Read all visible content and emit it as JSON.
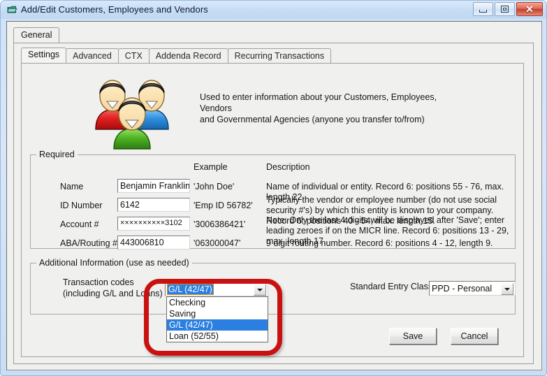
{
  "window": {
    "title": "Add/Edit Customers, Employees and Vendors",
    "icon": "window-folder-icon",
    "minimize_label": "",
    "maximize_label": "",
    "close_label": "✕"
  },
  "outer_tabs": [
    {
      "label": "General",
      "active": true
    }
  ],
  "inner_tabs": [
    {
      "label": "Settings",
      "active": true
    },
    {
      "label": "Advanced",
      "active": false
    },
    {
      "label": "CTX",
      "active": false
    },
    {
      "label": "Addenda Record",
      "active": false
    },
    {
      "label": "Recurring Transactions",
      "active": false
    }
  ],
  "intro": {
    "line1": "Used to enter information about your Customers, Employees, Vendors",
    "line2": "and Governmental Agencies (anyone you transfer to/from)"
  },
  "required": {
    "legend": "Required",
    "headers": {
      "example": "Example",
      "description": "Description"
    },
    "rows": [
      {
        "label": "Name",
        "value": "Benjamin Franklin",
        "example": "'John Doe'",
        "description": "Name of individual or entity. Record 6: positions 55 - 76, max. length 22."
      },
      {
        "label": "ID Number",
        "value": "6142",
        "example": "'Emp ID 56782'",
        "description": "Typically the vendor or employee number (do not use social security #'s) by which this entity is known to your company. Record 6: positions 40 - 54, max. length 15."
      },
      {
        "label": "Account #",
        "value": "××××××××××3102",
        "example": "'3006386421'",
        "description": "Note: Only the last 4 digits will be displayed after 'Save'; enter leading zeroes if on the MICR line. Record 6: positions 13 - 29, max. length 17."
      },
      {
        "label": "ABA/Routing #",
        "value": "443006810",
        "example": "'063000047'",
        "description": "9 digit routing number. Record 6: positions 4 - 12, length 9."
      }
    ]
  },
  "additional": {
    "legend": "Additional Information (use as needed)",
    "transaction_codes": {
      "label_line1": "Transaction codes",
      "label_line2": "(including G/L and Loans)",
      "value": "G/L (42/47)",
      "expanded": true,
      "options": [
        {
          "label": "Checking",
          "selected": false
        },
        {
          "label": "Saving",
          "selected": false
        },
        {
          "label": "G/L (42/47)",
          "selected": true
        },
        {
          "label": "Loan (52/55)",
          "selected": false
        }
      ]
    },
    "standard_entry_class": {
      "label": "Standard Entry Class",
      "value": "PPD - Personal"
    }
  },
  "actions": {
    "save": "Save",
    "cancel": "Cancel"
  },
  "colors": {
    "titlebar": "#c6dcf4",
    "close_button": "#c23f27",
    "selection_blue": "#2a7fe0",
    "annotation_red": "#c9110f",
    "panel_bg": "#f0f0ee"
  },
  "annotation": {
    "shape": "rounded-rectangle-highlight",
    "target": "transaction-codes-combo"
  }
}
